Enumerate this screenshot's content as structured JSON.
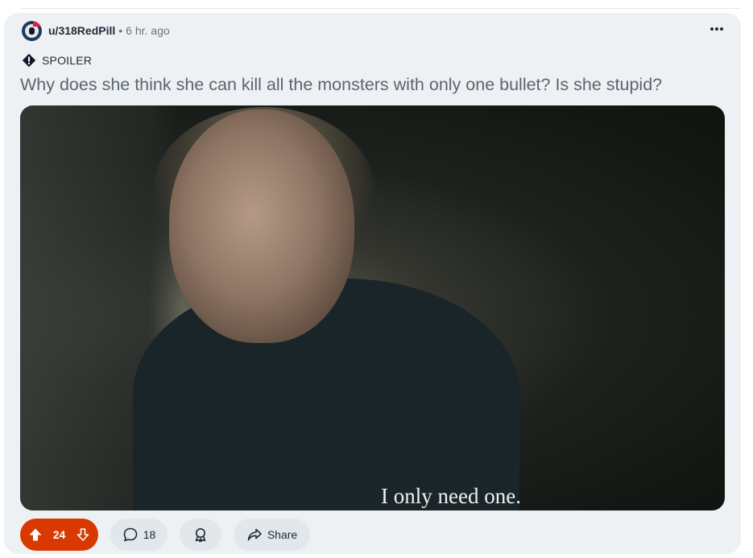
{
  "post": {
    "author": "u/318RedPill",
    "separator": "•",
    "time": "6 hr. ago",
    "spoiler_label": "SPOILER",
    "title": "Why does she think she can kill all the monsters with only one bullet? Is she stupid?",
    "media": {
      "subtitle": "I only need one."
    },
    "actions": {
      "vote_count": "24",
      "comment_count": "18",
      "share_label": "Share"
    }
  },
  "colors": {
    "accent": "#d93900",
    "card_bg": "#eef1f4",
    "pill_bg": "#e2e7eb",
    "title": "#5a6570"
  },
  "icons": [
    "more-icon",
    "spoiler-icon",
    "upvote-icon",
    "downvote-icon",
    "comment-icon",
    "award-icon",
    "share-icon"
  ]
}
